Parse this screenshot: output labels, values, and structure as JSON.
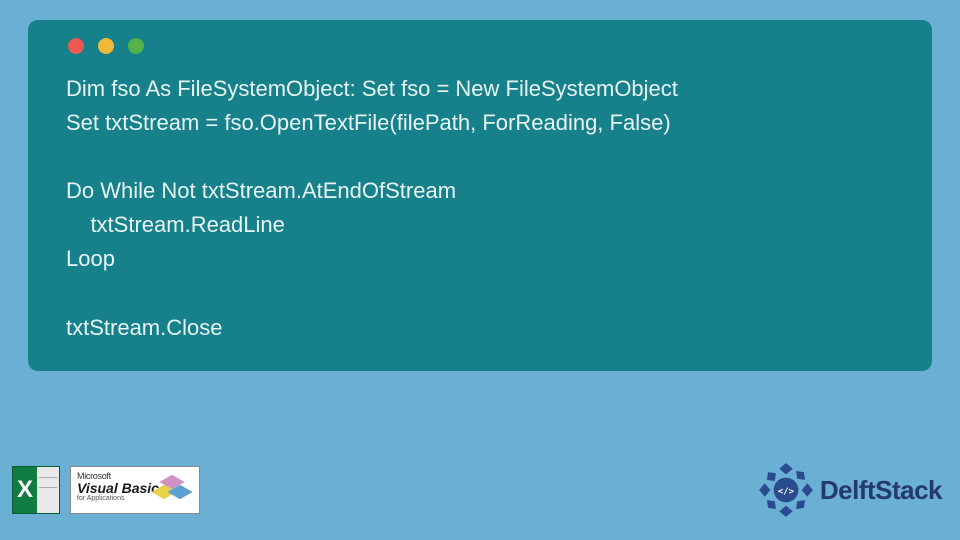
{
  "code": {
    "line1": "Dim fso As FileSystemObject: Set fso = New FileSystemObject",
    "line2": "Set txtStream = fso.OpenTextFile(filePath, ForReading, False)",
    "line3": "",
    "line4": "Do While Not txtStream.AtEndOfStream",
    "line5": "    txtStream.ReadLine",
    "line6": "Loop",
    "line7": "",
    "line8": "txtStream.Close"
  },
  "badges": {
    "excel_letter": "X",
    "vb_ms": "Microsoft",
    "vb_name": "Visual Basic",
    "vb_sub": "for Applications"
  },
  "brand": {
    "name": "DelftStack",
    "logo_glyph": "</>"
  }
}
